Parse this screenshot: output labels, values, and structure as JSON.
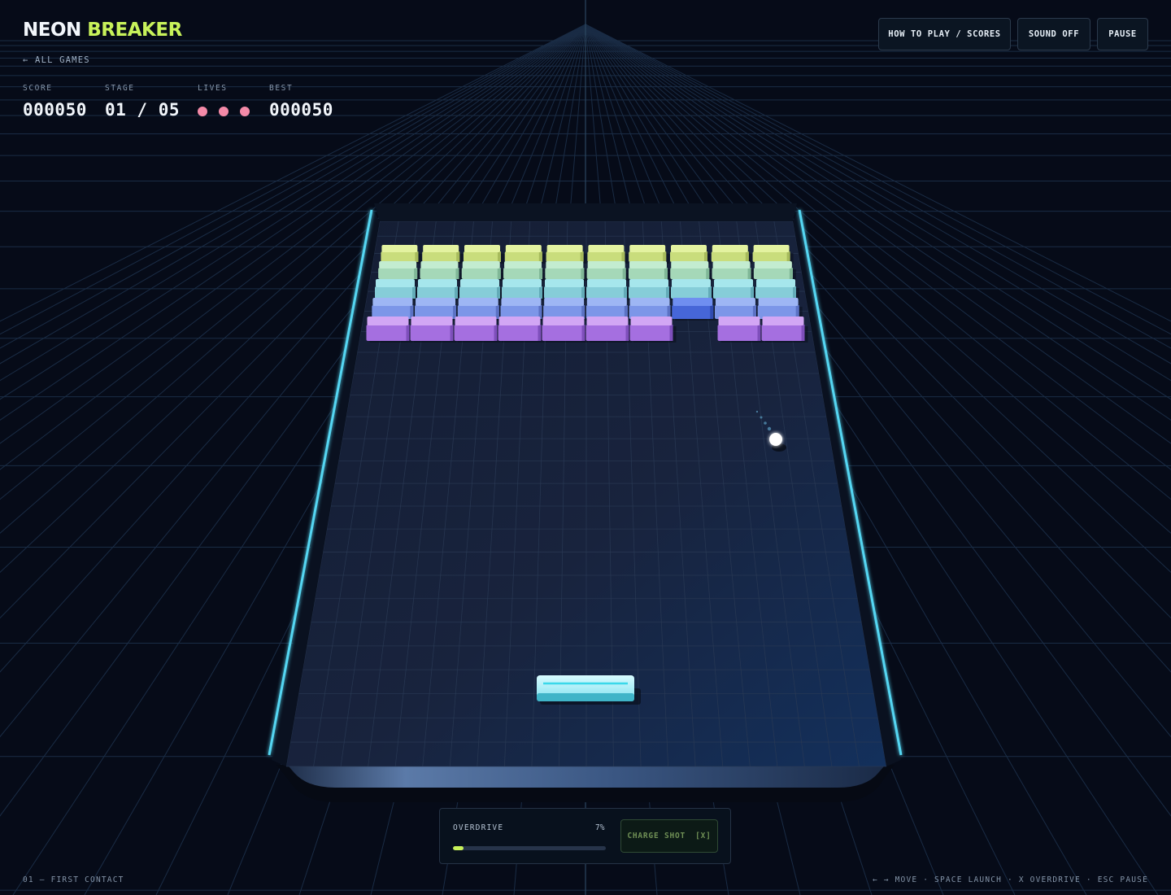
{
  "app": {
    "brand_main": "NEON",
    "brand_accent": "BREAKER",
    "back_link": "← ALL GAMES"
  },
  "hud": {
    "score_label": "SCORE",
    "score": "000050",
    "stage_label": "STAGE",
    "stage": "01 / 05",
    "lives_label": "LIVES",
    "lives": 3,
    "best_label": "BEST",
    "best": "000050"
  },
  "toolbar": {
    "how_to_play": "HOW TO PLAY / SCORES",
    "sound": "SOUND OFF",
    "pause": "PAUSE"
  },
  "overdrive": {
    "label": "OVERDRIVE",
    "percent_label": "7%",
    "fraction": 0.07,
    "charge_label": "CHARGE SHOT",
    "charge_key": "[X]"
  },
  "footer": {
    "level_name": "01 — FIRST CONTACT",
    "controls": "← → MOVE · SPACE LAUNCH · X OVERDRIVE · ESC PAUSE"
  },
  "game": {
    "brick_rows": [
      {
        "top": "#e3f2a0",
        "front": "#c9dd7c",
        "side": "#a7bb5c"
      },
      {
        "top": "#c3ecd0",
        "front": "#a5d8b8",
        "side": "#80b797"
      },
      {
        "top": "#a6e6ec",
        "front": "#86cdd8",
        "side": "#63abb8"
      },
      {
        "top": "#9eb6f4",
        "front": "#7c96e8",
        "side": "#5b72c4"
      },
      {
        "top": "#d2a6f4",
        "front": "#a56fe0",
        "side": "#7e4fbb"
      }
    ],
    "missing_bricks": [
      {
        "row": 4,
        "col": 7
      }
    ],
    "highlighted_bricks": [
      {
        "row": 3,
        "col": 7,
        "color": "#4666d8"
      }
    ],
    "colors": {
      "accent": "#c8f25a",
      "life": "#f48aa8",
      "wall": "#55d6f2",
      "danger_line": "#f0729a",
      "paddle": "#9ae8f2",
      "ball": "#ffffff"
    }
  }
}
